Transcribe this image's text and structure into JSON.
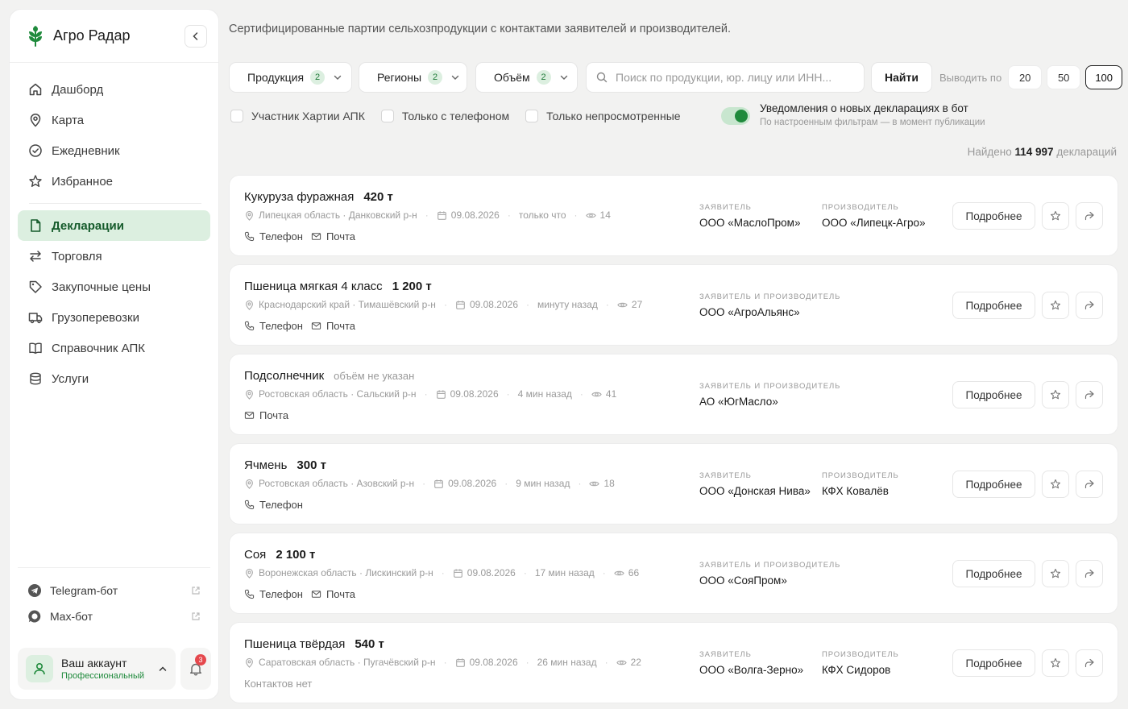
{
  "app": {
    "name": "Агро Радар"
  },
  "nav": {
    "items": [
      {
        "label": "Дашборд",
        "icon": "home-icon"
      },
      {
        "label": "Карта",
        "icon": "map-pin-icon"
      },
      {
        "label": "Ежедневник",
        "icon": "check-circle-icon"
      },
      {
        "label": "Избранное",
        "icon": "star-icon"
      }
    ],
    "items2": [
      {
        "label": "Декларации",
        "icon": "document-icon",
        "active": true
      },
      {
        "label": "Торговля",
        "icon": "arrows-icon"
      },
      {
        "label": "Закупочные цены",
        "icon": "tag-icon"
      },
      {
        "label": "Грузоперевозки",
        "icon": "truck-icon"
      },
      {
        "label": "Справочник АПК",
        "icon": "book-icon"
      },
      {
        "label": "Услуги",
        "icon": "database-icon"
      }
    ]
  },
  "bots": [
    {
      "label": "Telegram-бот",
      "icon": "telegram-icon"
    },
    {
      "label": "Max-бот",
      "icon": "chat-bubble-icon"
    }
  ],
  "account": {
    "name": "Ваш аккаунт",
    "plan": "Профессиональный",
    "notifications": "3"
  },
  "header": {
    "subtitle": "Сертифицированные партии сельхозпродукции с контактами заявителей и производителей."
  },
  "filters": {
    "products": {
      "label": "Продукция",
      "count": "2"
    },
    "regions": {
      "label": "Регионы",
      "count": "2"
    },
    "volume": {
      "label": "Объём",
      "count": "2"
    },
    "search_placeholder": "Поиск по продукции, юр. лицу или ИНН...",
    "search_value": "",
    "find_label": "Найти",
    "per_page_label": "Выводить по",
    "per_page_options": [
      "20",
      "50",
      "100"
    ],
    "per_page_selected": "100"
  },
  "checks": [
    {
      "label": "Участник Хартии АПК",
      "checked": false
    },
    {
      "label": "Только с телефоном",
      "checked": false
    },
    {
      "label": "Только непросмотренные",
      "checked": false
    }
  ],
  "notify": {
    "enabled": true,
    "title": "Уведомления о новых декларациях в бот",
    "subtitle": "По настроенным фильтрам — в момент публикации"
  },
  "found": {
    "prefix": "Найдено",
    "count": "114 997",
    "suffix": "деклараций"
  },
  "labels": {
    "applicant": "Заявитель",
    "producer": "Производитель",
    "both": "Заявитель и производитель",
    "phone": "Телефон",
    "email": "Почта",
    "no_contacts": "Контактов нет",
    "more": "Подробнее"
  },
  "declarations": [
    {
      "product": "Кукуруза фуражная",
      "volume": "420 т",
      "location": "Липецкая область · Данковский р-н",
      "date": "09.08.2026",
      "ago": "только что",
      "views": "14",
      "contacts": [
        "phone",
        "email"
      ],
      "applicant": "ООО «МаслоПром»",
      "producer": "ООО «Липецк-Агро»",
      "same": false
    },
    {
      "product": "Пшеница мягкая 4 класс",
      "volume": "1 200 т",
      "location": "Краснодарский край · Тимашёвский р-н",
      "date": "09.08.2026",
      "ago": "минуту назад",
      "views": "27",
      "contacts": [
        "phone",
        "email"
      ],
      "applicant": "ООО «АгроАльянс»",
      "producer": "",
      "same": true
    },
    {
      "product": "Подсолнечник",
      "volume": "объём не указан",
      "volume_na": true,
      "location": "Ростовская область · Сальский р-н",
      "date": "09.08.2026",
      "ago": "4 мин назад",
      "views": "41",
      "contacts": [
        "email"
      ],
      "applicant": "АО «ЮгМасло»",
      "producer": "",
      "same": true
    },
    {
      "product": "Ячмень",
      "volume": "300 т",
      "location": "Ростовская область · Азовский р-н",
      "date": "09.08.2026",
      "ago": "9 мин назад",
      "views": "18",
      "contacts": [
        "phone"
      ],
      "applicant": "ООО «Донская Нива»",
      "producer": "КФХ Ковалёв",
      "same": false
    },
    {
      "product": "Соя",
      "volume": "2 100 т",
      "location": "Воронежская область · Лискинский р-н",
      "date": "09.08.2026",
      "ago": "17 мин назад",
      "views": "66",
      "contacts": [
        "phone",
        "email"
      ],
      "applicant": "ООО «СояПром»",
      "producer": "",
      "same": true
    },
    {
      "product": "Пшеница твёрдая",
      "volume": "540 т",
      "location": "Саратовская область · Пугачёвский р-н",
      "date": "09.08.2026",
      "ago": "26 мин назад",
      "views": "22",
      "contacts": [],
      "applicant": "ООО «Волга-Зерно»",
      "producer": "КФХ Сидоров",
      "same": false
    }
  ],
  "colors": {
    "accent": "#1f8a3c",
    "accent_bg": "#dcefe0",
    "badge": "#e5484d"
  }
}
